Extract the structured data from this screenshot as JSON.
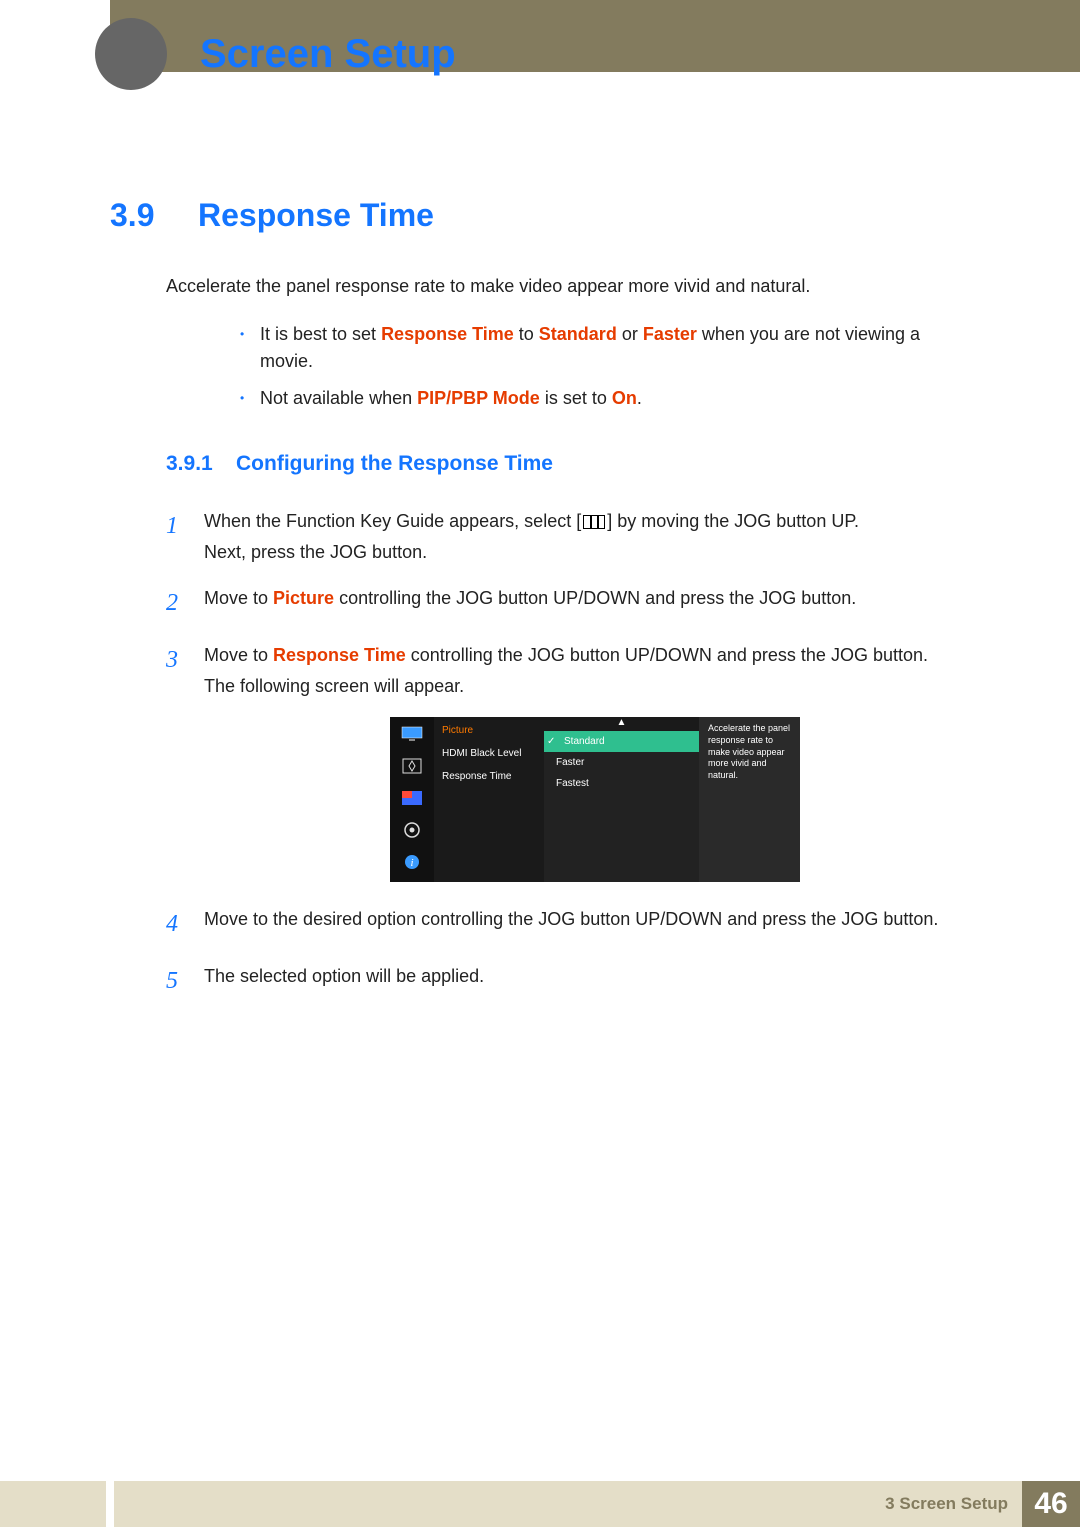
{
  "header": {
    "chapter_title": "Screen Setup"
  },
  "section": {
    "num": "3.9",
    "title": "Response Time",
    "intro": "Accelerate the panel response rate to make video appear more vivid and natural.",
    "notes": {
      "b1_pre": "It is best to set ",
      "b1_h1": "Response Time",
      "b1_mid1": " to ",
      "b1_h2": "Standard",
      "b1_mid2": " or ",
      "b1_h3": "Faster",
      "b1_post": " when you are not viewing a movie.",
      "b2_pre": "Not available when ",
      "b2_h1": "PIP/PBP Mode",
      "b2_mid": " is set to ",
      "b2_h2": "On",
      "b2_post": "."
    }
  },
  "subsection": {
    "num": "3.9.1",
    "title": "Configuring the Response Time"
  },
  "steps": {
    "s1_num": "1",
    "s1_a": "When the Function Key Guide appears, select [",
    "s1_b": "] by moving the JOG button UP.",
    "s1_c": "Next, press the JOG button.",
    "s2_num": "2",
    "s2_a": "Move to ",
    "s2_h": "Picture",
    "s2_b": " controlling the JOG button UP/DOWN and press the JOG button.",
    "s3_num": "3",
    "s3_a": "Move to ",
    "s3_h": "Response Time",
    "s3_b": " controlling the JOG button UP/DOWN and press the JOG button.",
    "s3_c": "The following screen will appear.",
    "s4_num": "4",
    "s4": "Move to the desired option controlling the JOG button UP/DOWN and press the JOG button.",
    "s5_num": "5",
    "s5": "The selected option will be applied."
  },
  "osd": {
    "category": "Picture",
    "items": {
      "i1": "HDMI Black Level",
      "i2": "Response Time"
    },
    "arrow": "▲",
    "options": {
      "o1": "Standard",
      "o2": "Faster",
      "o3": "Fastest"
    },
    "help": "Accelerate the panel response rate to make video appear more vivid and natural."
  },
  "footer": {
    "text": "3 Screen Setup",
    "page": "46"
  }
}
